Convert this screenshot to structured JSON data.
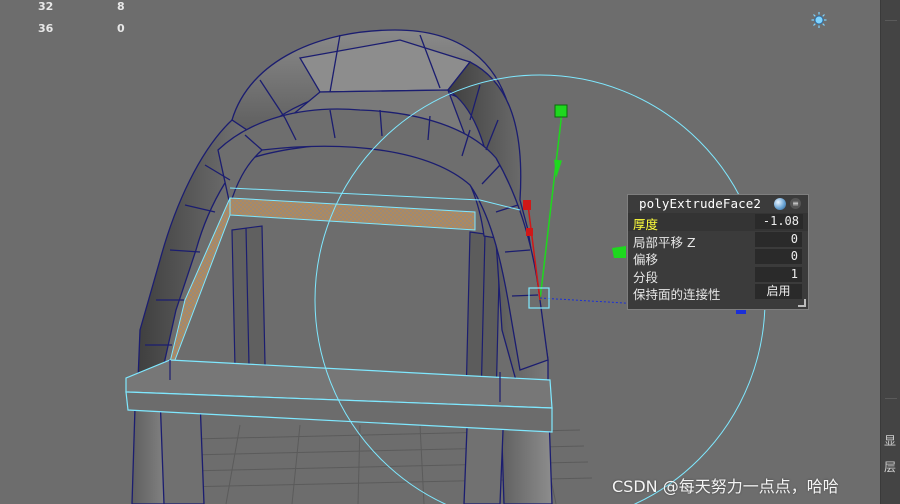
{
  "hud": {
    "rows": [
      {
        "a": "32",
        "b": "8"
      },
      {
        "a": "36",
        "b": "0"
      }
    ]
  },
  "panel": {
    "title": "polyExtrudeFace2",
    "rows": [
      {
        "label": "厚度",
        "value": "-1.08"
      },
      {
        "label": "局部平移 Z",
        "value": "0"
      },
      {
        "label": "偏移",
        "value": "0"
      },
      {
        "label": "分段",
        "value": "1"
      },
      {
        "label": "保持面的连接性",
        "value": "启用"
      }
    ]
  },
  "watermark": "CSDN @每天努力一点点，哈哈",
  "right_strip": {
    "labels": [
      "显",
      "层"
    ]
  },
  "colors": {
    "viewport_bg": "#6d6d6d",
    "wire": "#1b1d70",
    "selection": "#7fe8ff",
    "highlight_label": "#ffff3a",
    "gizmo_y": "#1ed81e",
    "gizmo_x": "#d01818",
    "gizmo_z": "#1a2fd8"
  },
  "icons": [
    "lights-icon",
    "globe-icon",
    "options-icon",
    "resize-grip-icon"
  ]
}
